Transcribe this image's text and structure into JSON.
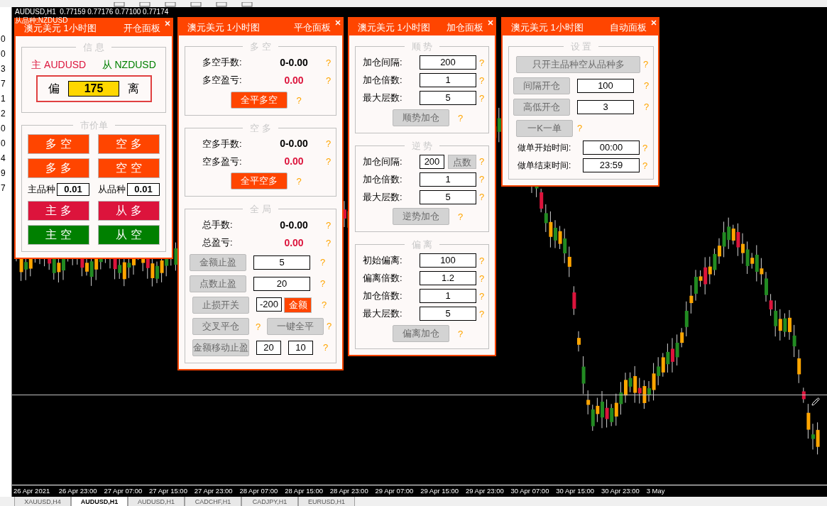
{
  "left_strip": {
    "digits": [
      "0",
      "0",
      "3",
      "7",
      "1",
      "2",
      "0",
      "0",
      "4",
      "9",
      "7"
    ]
  },
  "chart": {
    "header": "AUDUSD,H1  0.77159 0.77176 0.77100 0.77174",
    "overlay_label": "从品种:NZDUSD",
    "time_axis": [
      "26 Apr 2021",
      "26 Apr 23:00",
      "27 Apr 07:00",
      "27 Apr 15:00",
      "27 Apr 23:00",
      "28 Apr 07:00",
      "28 Apr 15:00",
      "28 Apr 23:00",
      "29 Apr 07:00",
      "29 Apr 15:00",
      "29 Apr 23:00",
      "30 Apr 07:00",
      "30 Apr 15:00",
      "30 Apr 23:00",
      "3 May"
    ]
  },
  "panels": [
    {
      "title": "澳元美元 1小时图",
      "name": "开仓面板",
      "sections": [
        {
          "legend": "信 息",
          "rows": [
            {
              "kind": "symbols",
              "main": "主 AUDUSD",
              "sub": "从 NZDUSD"
            },
            {
              "kind": "deviation",
              "left": "偏",
              "value": "175",
              "right": "离"
            }
          ]
        },
        {
          "legend": "市价单",
          "rows": [
            {
              "kind": "button_pair",
              "buttons": [
                {
                  "label": "多 空",
                  "color": "#ff4500"
                },
                {
                  "label": "空 多",
                  "color": "#ff4500"
                }
              ]
            },
            {
              "kind": "button_pair",
              "buttons": [
                {
                  "label": "多 多",
                  "color": "#ff4500"
                },
                {
                  "label": "空 空",
                  "color": "#ff4500"
                }
              ]
            },
            {
              "kind": "lots",
              "items": [
                {
                  "label": "主品种",
                  "value": "0.01"
                },
                {
                  "label": "从品种",
                  "value": "0.01"
                }
              ]
            },
            {
              "kind": "button_pair",
              "buttons": [
                {
                  "label": "主 多",
                  "color": "#dc143c"
                },
                {
                  "label": "从 多",
                  "color": "#dc143c"
                }
              ]
            },
            {
              "kind": "button_pair",
              "buttons": [
                {
                  "label": "主 空",
                  "color": "#008000"
                },
                {
                  "label": "从 空",
                  "color": "#008000"
                }
              ]
            }
          ]
        }
      ]
    },
    {
      "title": "澳元美元 1小时图",
      "name": "平仓面板",
      "sections": [
        {
          "legend": "多 空",
          "rows": [
            {
              "kind": "stat",
              "label": "多空手数:",
              "value": "0-0.00",
              "color": "#000000",
              "help": "?"
            },
            {
              "kind": "stat",
              "label": "多空盈亏:",
              "value": "0.00",
              "color": "#dc143c",
              "help": "?"
            },
            {
              "kind": "action",
              "button": {
                "label": "全平多空",
                "active": true
              },
              "help": "?"
            }
          ]
        },
        {
          "legend": "空 多",
          "rows": [
            {
              "kind": "stat",
              "label": "空多手数:",
              "value": "0-0.00",
              "color": "#000000",
              "help": "?"
            },
            {
              "kind": "stat",
              "label": "空多盈亏:",
              "value": "0.00",
              "color": "#dc143c",
              "help": "?"
            },
            {
              "kind": "action",
              "button": {
                "label": "全平空多",
                "active": true
              },
              "help": "?"
            }
          ]
        },
        {
          "legend": "全 局",
          "rows": [
            {
              "kind": "stat",
              "label": "总手数:",
              "value": "0-0.00",
              "color": "#000000",
              "help": "?"
            },
            {
              "kind": "stat",
              "label": "总盈亏:",
              "value": "0.00",
              "color": "#dc143c",
              "help": "?"
            },
            {
              "kind": "button_field",
              "button": {
                "label": "金额止盈",
                "active": false
              },
              "value": "5",
              "help": "?"
            },
            {
              "kind": "button_field",
              "button": {
                "label": "点数止盈",
                "active": false
              },
              "value": "20",
              "help": "?"
            },
            {
              "kind": "button_field_toggle",
              "button": {
                "label": "止损开关",
                "active": false
              },
              "value": "-200",
              "toggle": {
                "label": "金额",
                "active": true
              },
              "help": "?"
            },
            {
              "kind": "two_buttons",
              "button": {
                "label": "交叉平仓",
                "active": false
              },
              "help": "?",
              "button2": {
                "label": "一键全平",
                "active": false
              },
              "help2": "?"
            },
            {
              "kind": "button_two_fields",
              "button": {
                "label": "金额移动止盈",
                "active": false
              },
              "value": "20",
              "value2": "10",
              "help": "?"
            }
          ]
        }
      ]
    },
    {
      "title": "澳元美元 1小时图",
      "name": "加仓面板",
      "sections": [
        {
          "legend": "顺 势",
          "rows": [
            {
              "kind": "field",
              "label": "加仓间隔:",
              "value": "200",
              "help": "?"
            },
            {
              "kind": "field",
              "label": "加仓倍数:",
              "value": "1",
              "help": "?"
            },
            {
              "kind": "field",
              "label": "最大层数:",
              "value": "5",
              "help": "?"
            },
            {
              "kind": "action",
              "button": {
                "label": "顺势加仓",
                "active": false
              },
              "help": "?"
            }
          ]
        },
        {
          "legend": "逆 势",
          "rows": [
            {
              "kind": "field_button",
              "label": "加仓间隔:",
              "value": "200",
              "button": {
                "label": "点数",
                "active": false
              },
              "help": "?"
            },
            {
              "kind": "field",
              "label": "加仓倍数:",
              "value": "1",
              "help": "?"
            },
            {
              "kind": "field",
              "label": "最大层数:",
              "value": "5",
              "help": "?"
            },
            {
              "kind": "action",
              "button": {
                "label": "逆势加仓",
                "active": false
              },
              "help": "?"
            }
          ]
        },
        {
          "legend": "偏 离",
          "rows": [
            {
              "kind": "field",
              "label": "初始偏离:",
              "value": "100",
              "help": "?"
            },
            {
              "kind": "field",
              "label": "偏离倍数:",
              "value": "1.2",
              "help": "?"
            },
            {
              "kind": "field",
              "label": "加仓倍数:",
              "value": "1",
              "help": "?"
            },
            {
              "kind": "field",
              "label": "最大层数:",
              "value": "5",
              "help": "?"
            },
            {
              "kind": "action",
              "button": {
                "label": "偏离加仓",
                "active": false
              },
              "help": "?"
            }
          ]
        }
      ]
    },
    {
      "title": "澳元美元 1小时图",
      "name": "自动面板",
      "sections": [
        {
          "legend": "设 置",
          "rows": [
            {
              "kind": "wide_button",
              "button": {
                "label": "只开主品种空从品种多",
                "active": false
              },
              "help": "?"
            },
            {
              "kind": "button_field",
              "button": {
                "label": "间隔开仓",
                "active": false
              },
              "value": "100",
              "help": "?"
            },
            {
              "kind": "button_field",
              "button": {
                "label": "高低开仓",
                "active": false
              },
              "value": "3",
              "help": "?"
            },
            {
              "kind": "button_only",
              "button": {
                "label": "一K一单",
                "active": false
              },
              "help": "?"
            },
            {
              "kind": "time_field",
              "label": "做单开始时间:",
              "value": "00:00",
              "help": "?"
            },
            {
              "kind": "time_field",
              "label": "做单结束时间:",
              "value": "23:59",
              "help": "?"
            }
          ]
        }
      ]
    }
  ],
  "bottom_tabs": [
    {
      "label": "XAUUSD,H4",
      "selected": false
    },
    {
      "label": "AUDUSD,H1",
      "selected": true
    },
    {
      "label": "AUDUSD,H1",
      "selected": false
    },
    {
      "label": "CADCHF,H1",
      "selected": false
    },
    {
      "label": "CADJPY,H1",
      "selected": false
    },
    {
      "label": "EURUSD,H1",
      "selected": false
    }
  ]
}
